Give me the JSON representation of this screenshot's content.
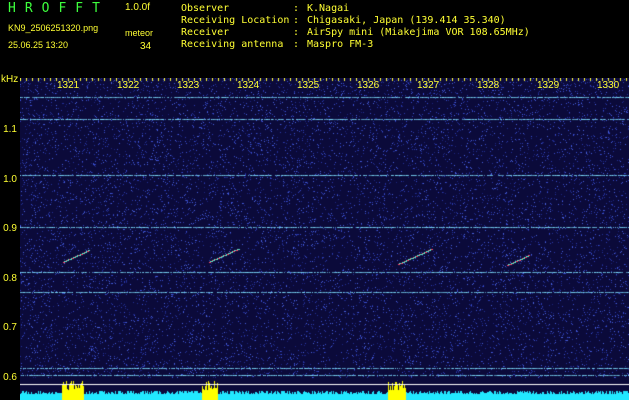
{
  "header": {
    "brand": "HROFFT",
    "version": "1.0.0f",
    "filename": "KN9_2506251320.png",
    "timestamp": "25.06.25 13:20",
    "metric_label": "meteor",
    "metric_value": "34"
  },
  "info": [
    {
      "label": "Observer",
      "value": "K.Nagai"
    },
    {
      "label": "Receiving Location",
      "value": "Chigasaki, Japan (139.414 35.340)"
    },
    {
      "label": "Receiver",
      "value": "AirSpy mini (Miakejima VOR 108.65MHz)"
    },
    {
      "label": "Receiving antenna",
      "value": "Maspro FM-3"
    }
  ],
  "spectrogram": {
    "y_axis_unit": "kHz",
    "y_ticks": [
      "1.1",
      "1.0",
      "0.9",
      "0.8",
      "0.7",
      "0.6"
    ],
    "x_ticks": [
      "1321",
      "1322",
      "1323",
      "1324",
      "1325",
      "1326",
      "1327",
      "1328",
      "1329",
      "1330"
    ],
    "y_range_khz": [
      0.58,
      1.14
    ],
    "carrier_lines_khz": [
      1.12,
      1.078,
      0.973,
      0.876,
      0.793,
      0.755,
      0.613,
      0.6
    ],
    "meteor_count": 34,
    "colors": {
      "background": "#0b0a3a",
      "noise": "#2c3cb0",
      "carrier": "#7fe0ff",
      "meteor": "#ff4a6a",
      "baseline": "#22e8ff",
      "baseline_peak": "#ffff00",
      "labels": "#ffff33",
      "brand": "#3dff3d"
    }
  }
}
